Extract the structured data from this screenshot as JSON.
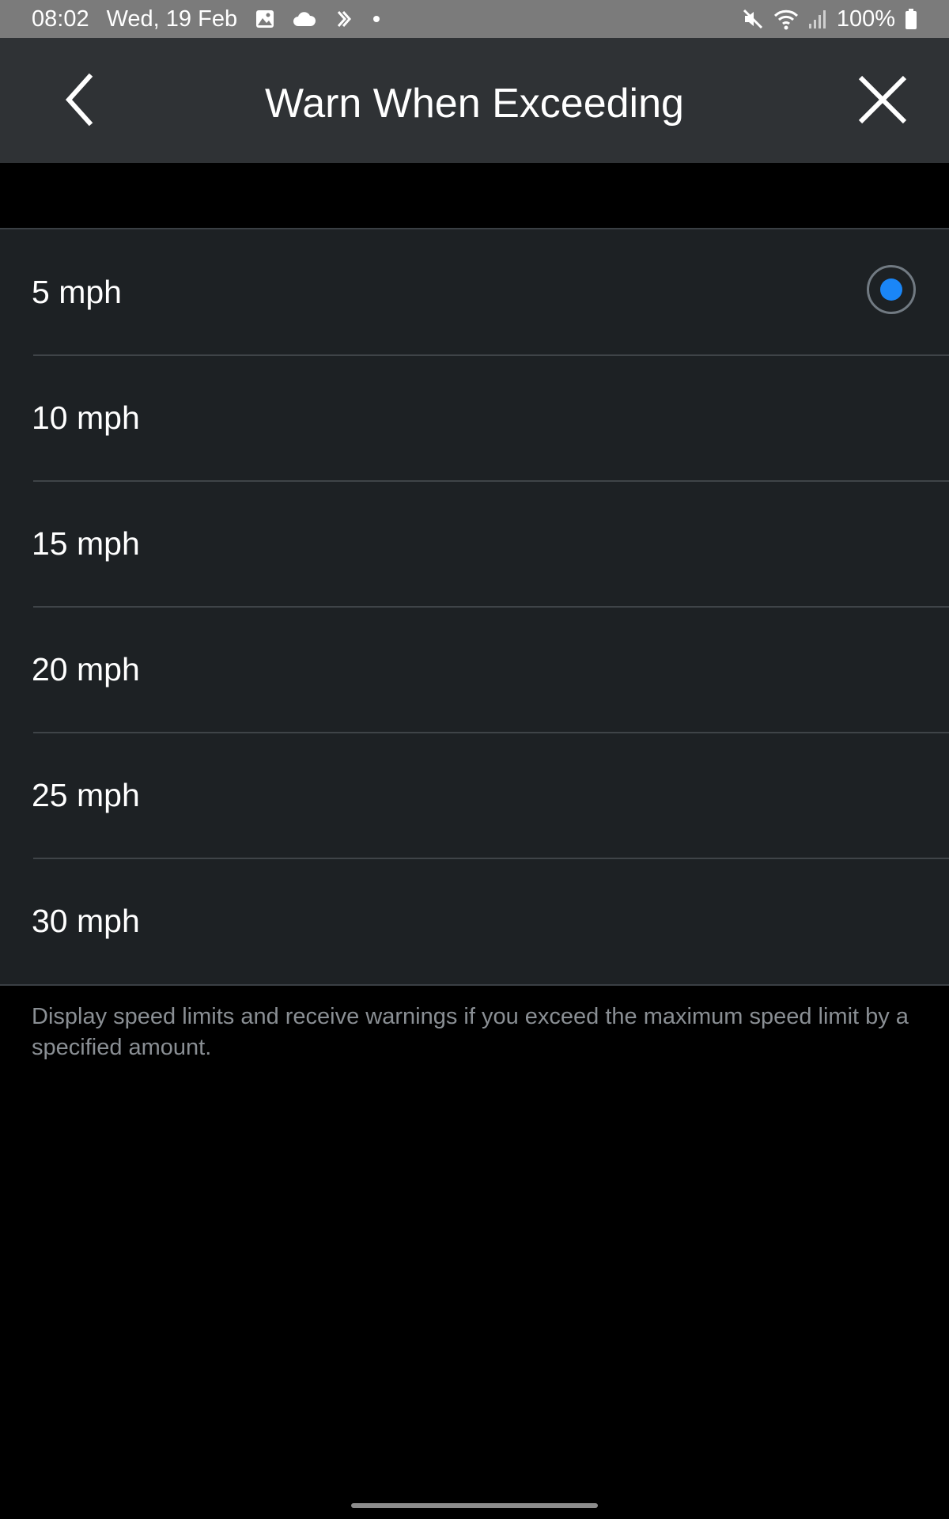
{
  "status_bar": {
    "time": "08:02",
    "date": "Wed, 19 Feb",
    "battery": "100%",
    "icons_left": [
      "gallery-icon",
      "cloud-icon",
      "sync-icon",
      "dot-icon"
    ],
    "icons_right": [
      "mute-icon",
      "wifi-icon",
      "signal-icon",
      "battery-icon"
    ]
  },
  "header": {
    "title": "Warn When Exceeding",
    "back_icon": "chevron-left-icon",
    "close_icon": "close-icon"
  },
  "options": {
    "items": [
      {
        "label": "5 mph",
        "selected": true
      },
      {
        "label": "10 mph",
        "selected": false
      },
      {
        "label": "15 mph",
        "selected": false
      },
      {
        "label": "20 mph",
        "selected": false
      },
      {
        "label": "25 mph",
        "selected": false
      },
      {
        "label": "30 mph",
        "selected": false
      }
    ]
  },
  "description": "Display speed limits and receive warnings if you exceed the maximum speed limit by a specified amount.",
  "colors": {
    "accent": "#1a86f7",
    "header_bg": "#2f3235",
    "list_bg": "#1d2124",
    "status_bar_bg": "#7b7b7b"
  }
}
